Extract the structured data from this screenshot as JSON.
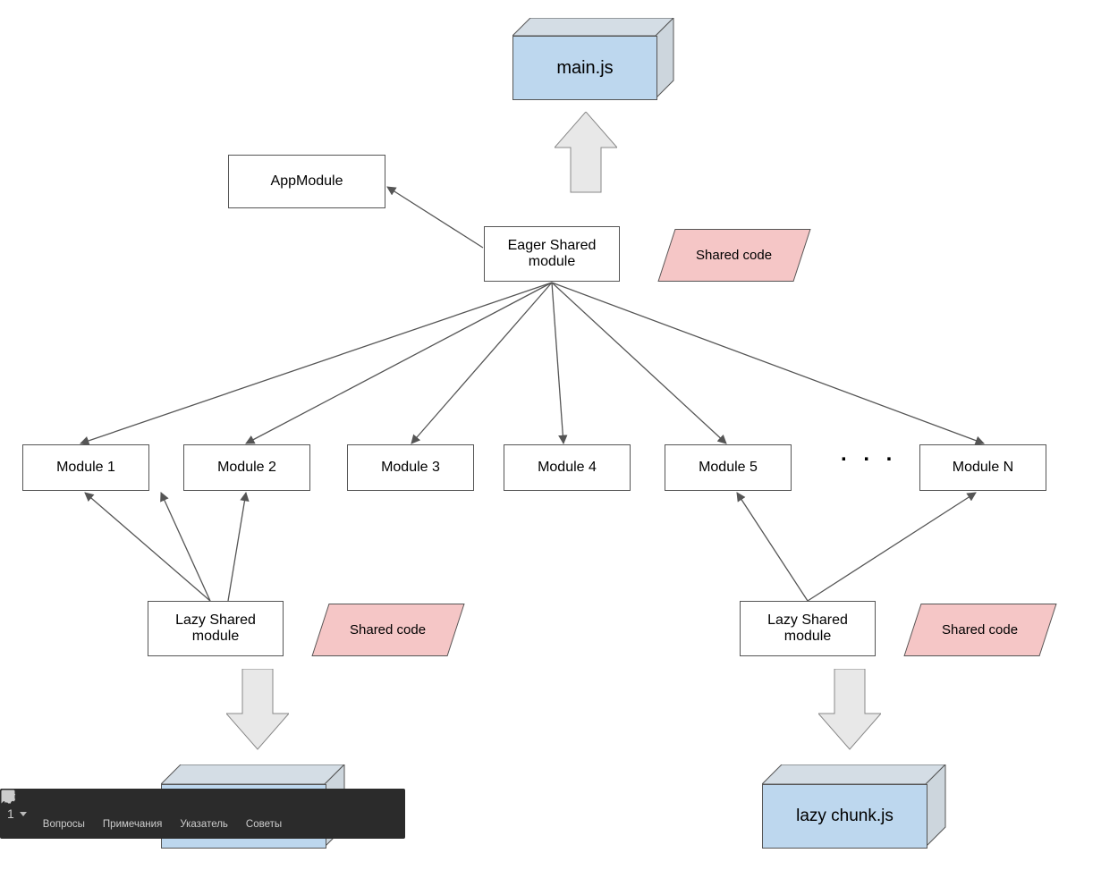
{
  "cube_main": "main.js",
  "app_module": "AppModule",
  "eager_shared": "Eager Shared\nmodule",
  "shared_code_top": "Shared code",
  "modules": [
    "Module 1",
    "Module 2",
    "Module 3",
    "Module 4",
    "Module 5",
    "Module N"
  ],
  "dots": ". . .",
  "lazy_left": "Lazy Shared\nmodule",
  "shared_left": "Shared code",
  "lazy_right": "Lazy Shared\nmodule",
  "shared_right": "Shared code",
  "cube_right": "lazy chunk.js",
  "toolbar": {
    "position": "1",
    "items": [
      "Вопросы",
      "Примечания",
      "Указатель",
      "Советы"
    ]
  }
}
